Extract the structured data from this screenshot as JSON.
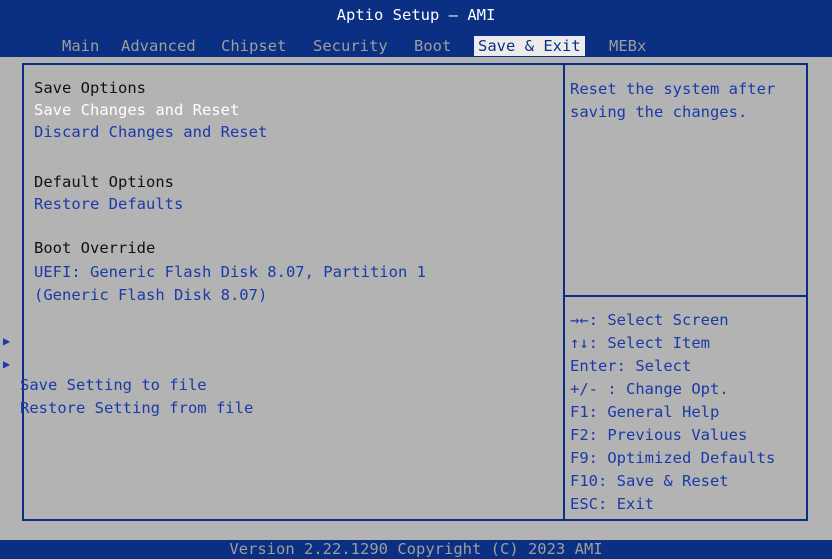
{
  "window": {
    "title": "Aptio Setup – AMI"
  },
  "tabs": [
    {
      "label": "Main"
    },
    {
      "label": "Advanced"
    },
    {
      "label": "Chipset"
    },
    {
      "label": "Security"
    },
    {
      "label": "Boot"
    },
    {
      "label": "Save & Exit",
      "active": true
    },
    {
      "label": "MEBx"
    }
  ],
  "left_panel": {
    "save_options_heading": "Save Options",
    "save_changes_reset": "Save Changes and Reset",
    "discard_changes_reset": "Discard Changes and Reset",
    "default_options_heading": "Default Options",
    "restore_defaults": "Restore Defaults",
    "boot_override_heading": "Boot Override",
    "boot_device_line1": "UEFI: Generic Flash Disk 8.07, Partition 1",
    "boot_device_line2": "(Generic Flash Disk 8.07)",
    "save_setting_to_file": "Save Setting to file",
    "restore_setting_from_file": "Restore Setting from file",
    "submenu_arrow": "▶"
  },
  "help_panel": {
    "description_line1": "Reset the system after",
    "description_line2": "saving the changes."
  },
  "key_legend": [
    "→←: Select Screen",
    "↑↓: Select Item",
    "Enter: Select",
    "+/- : Change Opt.",
    "F1: General Help",
    "F2: Previous Values",
    "F9: Optimized Defaults",
    "F10: Save & Reset",
    "ESC: Exit"
  ],
  "footer": {
    "version": "Version 2.22.1290 Copyright (C) 2023 AMI"
  },
  "colors": {
    "header_blue": "#0a2f83",
    "panel_gray": "#b3b3b3",
    "selectable_blue": "#1a3aa8",
    "selected_white": "#ffffff"
  }
}
